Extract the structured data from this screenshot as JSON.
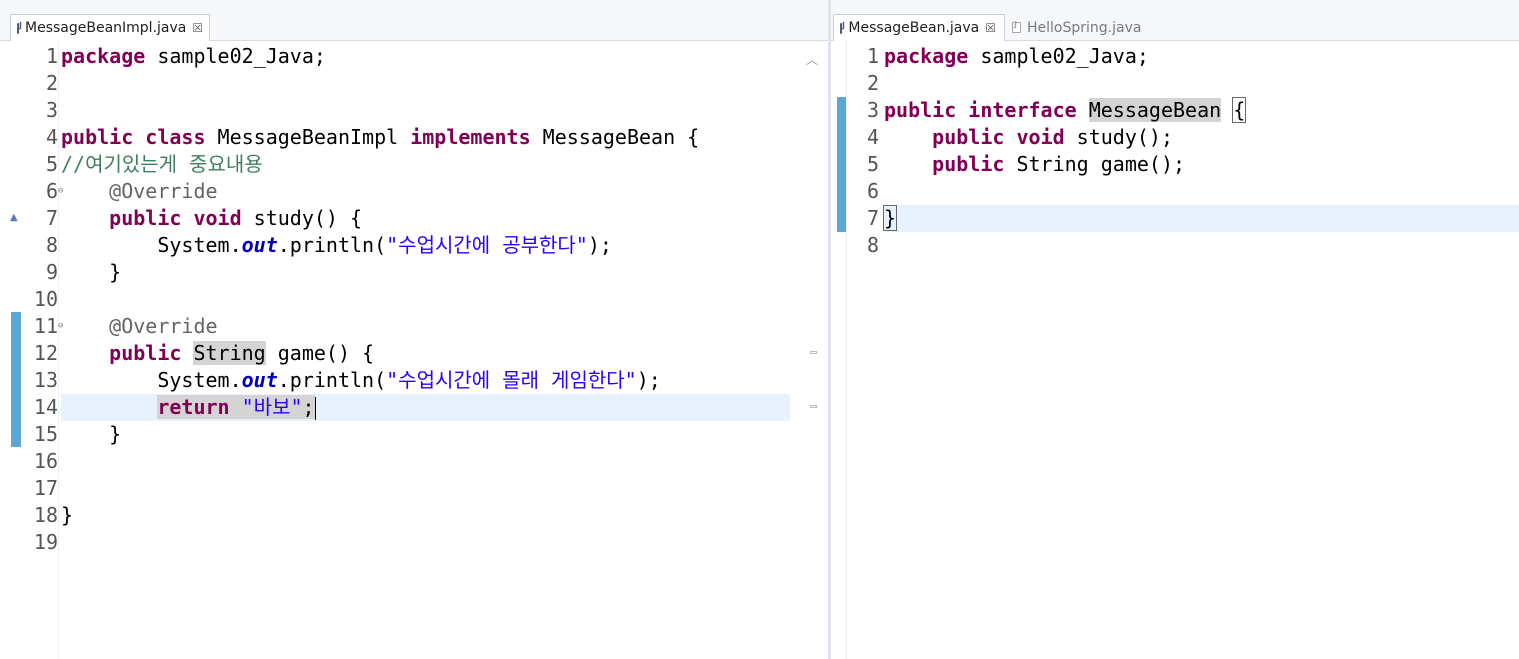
{
  "left_editor": {
    "tab": {
      "title": "MessageBeanImpl.java",
      "close": "☒"
    },
    "lines": [
      {
        "n": "1",
        "tokens": [
          {
            "t": "package",
            "c": "kw"
          },
          {
            "t": " sample02_Java;"
          }
        ]
      },
      {
        "n": "2",
        "tokens": []
      },
      {
        "n": "3",
        "tokens": []
      },
      {
        "n": "4",
        "tokens": [
          {
            "t": "public",
            "c": "kw"
          },
          {
            "t": " "
          },
          {
            "t": "class",
            "c": "kw"
          },
          {
            "t": " MessageBeanImpl "
          },
          {
            "t": "implements",
            "c": "kw"
          },
          {
            "t": " MessageBean {"
          }
        ]
      },
      {
        "n": "5",
        "tokens": [
          {
            "t": "//여기있는게 중요내용",
            "c": "cmt"
          }
        ]
      },
      {
        "n": "6",
        "tokens": [
          {
            "t": "    "
          },
          {
            "t": "@Override",
            "c": "ann"
          }
        ]
      },
      {
        "n": "7",
        "tokens": [
          {
            "t": "    "
          },
          {
            "t": "public",
            "c": "kw"
          },
          {
            "t": " "
          },
          {
            "t": "void",
            "c": "kw"
          },
          {
            "t": " study() {"
          }
        ]
      },
      {
        "n": "8",
        "tokens": [
          {
            "t": "        System."
          },
          {
            "t": "out",
            "c": "static-field"
          },
          {
            "t": ".println("
          },
          {
            "t": "\"수업시간에 공부한다\"",
            "c": "str"
          },
          {
            "t": ");"
          }
        ]
      },
      {
        "n": "9",
        "tokens": [
          {
            "t": "    }"
          }
        ]
      },
      {
        "n": "10",
        "tokens": []
      },
      {
        "n": "11",
        "tokens": [
          {
            "t": "    "
          },
          {
            "t": "@Override",
            "c": "ann"
          }
        ]
      },
      {
        "n": "12",
        "tokens": [
          {
            "t": "    "
          },
          {
            "t": "public",
            "c": "kw"
          },
          {
            "t": " "
          },
          {
            "t": "String",
            "c": "hl"
          },
          {
            "t": " game() {"
          }
        ]
      },
      {
        "n": "13",
        "tokens": [
          {
            "t": "        System."
          },
          {
            "t": "out",
            "c": "static-field"
          },
          {
            "t": ".println("
          },
          {
            "t": "\"수업시간에 몰래 게임한다\"",
            "c": "str"
          },
          {
            "t": ");"
          }
        ]
      },
      {
        "n": "14",
        "tokens": [
          {
            "t": "        "
          },
          {
            "t": "return",
            "c": "kw hl"
          },
          {
            "t": " ",
            "c": "hl"
          },
          {
            "t": "\"바보\"",
            "c": "str hl"
          },
          {
            "t": ";",
            "c": "hl"
          },
          {
            "t": "",
            "c": "caret"
          }
        ]
      },
      {
        "n": "15",
        "tokens": [
          {
            "t": "    }"
          }
        ]
      },
      {
        "n": "16",
        "tokens": []
      },
      {
        "n": "17",
        "tokens": []
      },
      {
        "n": "18",
        "tokens": [
          {
            "t": "}"
          }
        ]
      },
      {
        "n": "19",
        "tokens": []
      }
    ]
  },
  "right_editor": {
    "tabs": [
      {
        "title": "MessageBean.java",
        "close": "☒",
        "active": true
      },
      {
        "title": "HelloSpring.java",
        "active": false
      }
    ],
    "lines": [
      {
        "n": "1",
        "tokens": [
          {
            "t": "package",
            "c": "kw"
          },
          {
            "t": " sample02_Java;"
          }
        ]
      },
      {
        "n": "2",
        "tokens": []
      },
      {
        "n": "3",
        "tokens": [
          {
            "t": "public",
            "c": "kw"
          },
          {
            "t": " "
          },
          {
            "t": "interface",
            "c": "kw"
          },
          {
            "t": " "
          },
          {
            "t": "MessageBean",
            "c": "hl"
          },
          {
            "t": " "
          },
          {
            "t": "{",
            "c": "bracket"
          }
        ]
      },
      {
        "n": "4",
        "tokens": [
          {
            "t": "    "
          },
          {
            "t": "public",
            "c": "kw"
          },
          {
            "t": " "
          },
          {
            "t": "void",
            "c": "kw"
          },
          {
            "t": " study();"
          }
        ]
      },
      {
        "n": "5",
        "tokens": [
          {
            "t": "    "
          },
          {
            "t": "public",
            "c": "kw"
          },
          {
            "t": " String game();"
          }
        ]
      },
      {
        "n": "6",
        "tokens": []
      },
      {
        "n": "7",
        "tokens": [
          {
            "t": "}",
            "c": "bracket"
          }
        ]
      },
      {
        "n": "8",
        "tokens": []
      }
    ]
  },
  "icons": {
    "file": "java-file-icon",
    "close": "close-icon",
    "fold": "fold-collapse-icon",
    "override": "override-triangle-icon"
  }
}
